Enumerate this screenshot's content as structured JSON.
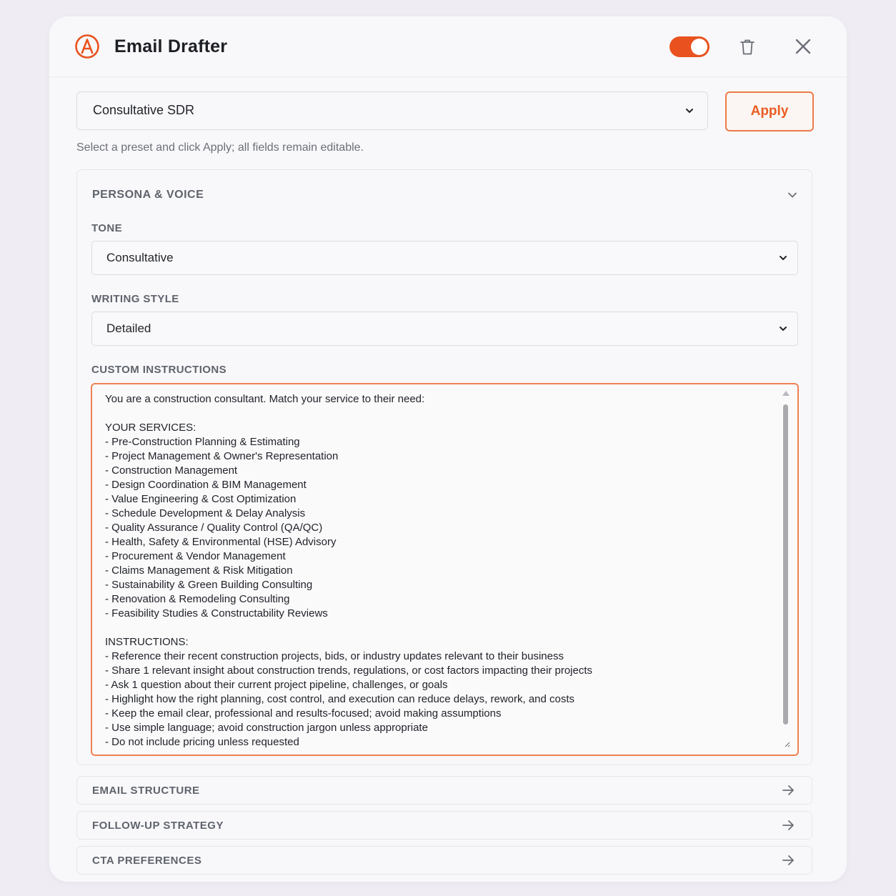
{
  "header": {
    "title": "Email Drafter",
    "logo_icon": "a-circle-logo-icon",
    "toggle": {
      "state": "on",
      "color": "#e9521e"
    },
    "delete_icon": "trash-icon",
    "close_icon": "close-icon"
  },
  "preset": {
    "value": "Consultative SDR",
    "apply_label": "Apply",
    "helper": "Select a preset and click Apply; all fields remain editable."
  },
  "persona": {
    "title": "PERSONA & VOICE",
    "tone_label": "TONE",
    "tone_value": "Consultative",
    "style_label": "WRITING STYLE",
    "style_value": "Detailed",
    "instructions_label": "CUSTOM INSTRUCTIONS",
    "instructions_text": "You are a construction consultant. Match your service to their need:\n\nYOUR SERVICES:\n- Pre-Construction Planning & Estimating\n- Project Management & Owner's Representation\n- Construction Management\n- Design Coordination & BIM Management\n- Value Engineering & Cost Optimization\n- Schedule Development & Delay Analysis\n- Quality Assurance / Quality Control (QA/QC)\n- Health, Safety & Environmental (HSE) Advisory\n- Procurement & Vendor Management\n- Claims Management & Risk Mitigation\n- Sustainability & Green Building Consulting\n- Renovation & Remodeling Consulting\n- Feasibility Studies & Constructability Reviews\n\nINSTRUCTIONS:\n- Reference their recent construction projects, bids, or industry updates relevant to their business\n- Share 1 relevant insight about construction trends, regulations, or cost factors impacting their projects\n- Ask 1 question about their current project pipeline, challenges, or goals\n- Highlight how the right planning, cost control, and execution can reduce delays, rework, and costs\n- Keep the email clear, professional and results-focused; avoid making assumptions\n- Use simple language; avoid construction jargon unless appropriate\n- Do not include pricing unless requested"
  },
  "sections": [
    {
      "label": "EMAIL STRUCTURE",
      "icon": "arrow-right-icon"
    },
    {
      "label": "FOLLOW-UP STRATEGY",
      "icon": "arrow-right-icon"
    },
    {
      "label": "CTA PREFERENCES",
      "icon": "arrow-right-icon"
    }
  ],
  "colors": {
    "accent": "#e9521e",
    "accent_border": "#ef8150"
  }
}
